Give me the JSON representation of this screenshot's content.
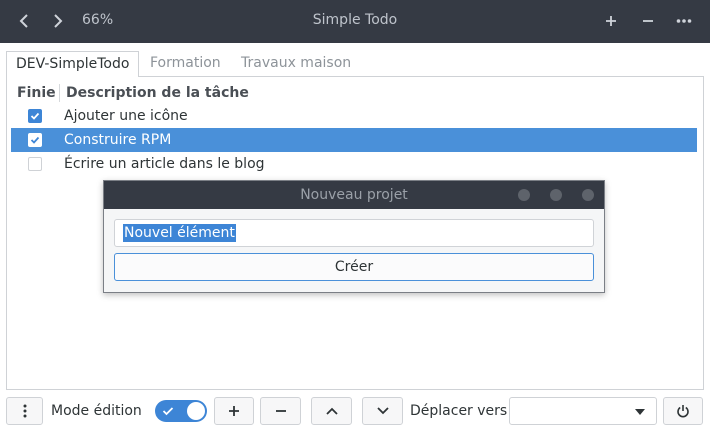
{
  "header": {
    "zoom": "66%",
    "title": "Simple Todo"
  },
  "tabs": [
    {
      "label": "DEV-SimpleTodo",
      "active": true
    },
    {
      "label": "Formation",
      "active": false
    },
    {
      "label": "Travaux maison",
      "active": false
    }
  ],
  "table": {
    "col_done": "Finie",
    "col_desc": "Description de la tâche",
    "rows": [
      {
        "done": true,
        "text": "Ajouter une icône",
        "selected": false
      },
      {
        "done": true,
        "text": "Construire RPM",
        "selected": true
      },
      {
        "done": false,
        "text": "Écrire un article dans le blog",
        "selected": false
      }
    ]
  },
  "dialog": {
    "title": "Nouveau projet",
    "input_value": "Nouvel élément",
    "create_label": "Créer"
  },
  "footer": {
    "edit_mode_label": "Mode édition",
    "edit_mode_on": true,
    "move_to_label": "Déplacer vers",
    "move_to_value": ""
  },
  "colors": {
    "accent": "#4a90d9",
    "headerbar": "#353a44"
  }
}
